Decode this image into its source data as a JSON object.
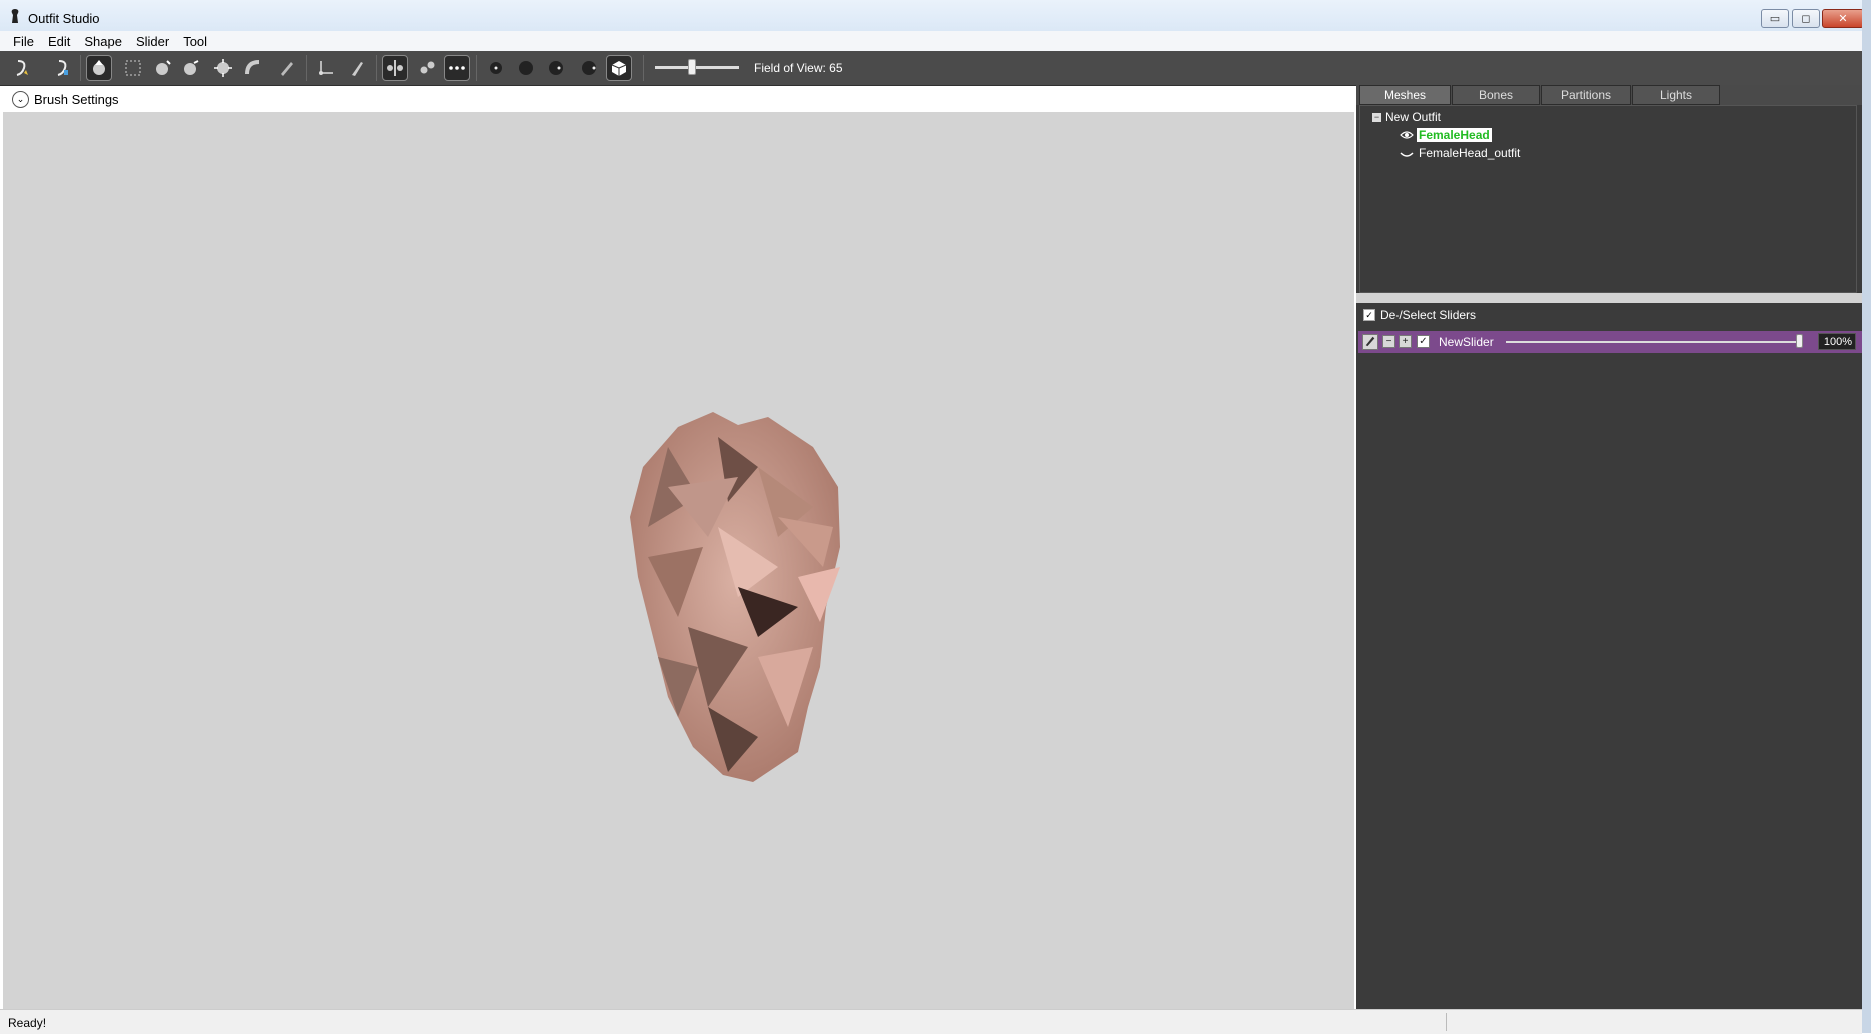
{
  "window": {
    "title": "Outfit Studio",
    "minimize": "▭",
    "maximize": "◻",
    "close": "✕"
  },
  "menu": [
    "File",
    "Edit",
    "Shape",
    "Slider",
    "Tool"
  ],
  "toolbar": {
    "tools": [
      "select-slider-icon",
      "select-tool-icon",
      "brush-inflate-icon",
      "select-box-icon",
      "brush-deflate-icon",
      "brush-move-icon",
      "brush-smooth-icon",
      "brush-transform-icon",
      "brush-undiff-icon",
      "brush-weight-icon",
      "axis-transform-icon",
      "paint-icon",
      "mirror-icon",
      "mirror-points-icon",
      "show-points-icon",
      "dot-small-icon",
      "dot-medium-icon",
      "dot-large-icon",
      "dot-xlarge-icon",
      "cube-icon"
    ],
    "fov_label": "Field of View: 65",
    "fov_value": 65
  },
  "viewport": {
    "brush_settings_label": "Brush Settings",
    "chevron": "⌄"
  },
  "right_panel": {
    "tabs": [
      "Meshes",
      "Bones",
      "Partitions",
      "Lights"
    ],
    "selected_tab": "Meshes",
    "tree": {
      "collapse_symbol": "−",
      "root": "New Outfit",
      "meshes": [
        {
          "name": "FemaleHead",
          "selected": true
        },
        {
          "name": "FemaleHead_outfit",
          "selected": false
        }
      ]
    },
    "sliders": {
      "deselect_label": "De-/Select Sliders",
      "check": "✓",
      "items": [
        {
          "name": "NewSlider",
          "value": "100%",
          "level": 1.0,
          "minus": "−",
          "plus": "+"
        }
      ]
    }
  },
  "status": {
    "text": "Ready!"
  },
  "colors": {
    "slider_row": "#7c4a8c",
    "selected_mesh_text": "#22bb22",
    "viewport_bg": "#d3d3d3",
    "panel_bg": "#3b3b3b",
    "skin": "#c9a091"
  }
}
